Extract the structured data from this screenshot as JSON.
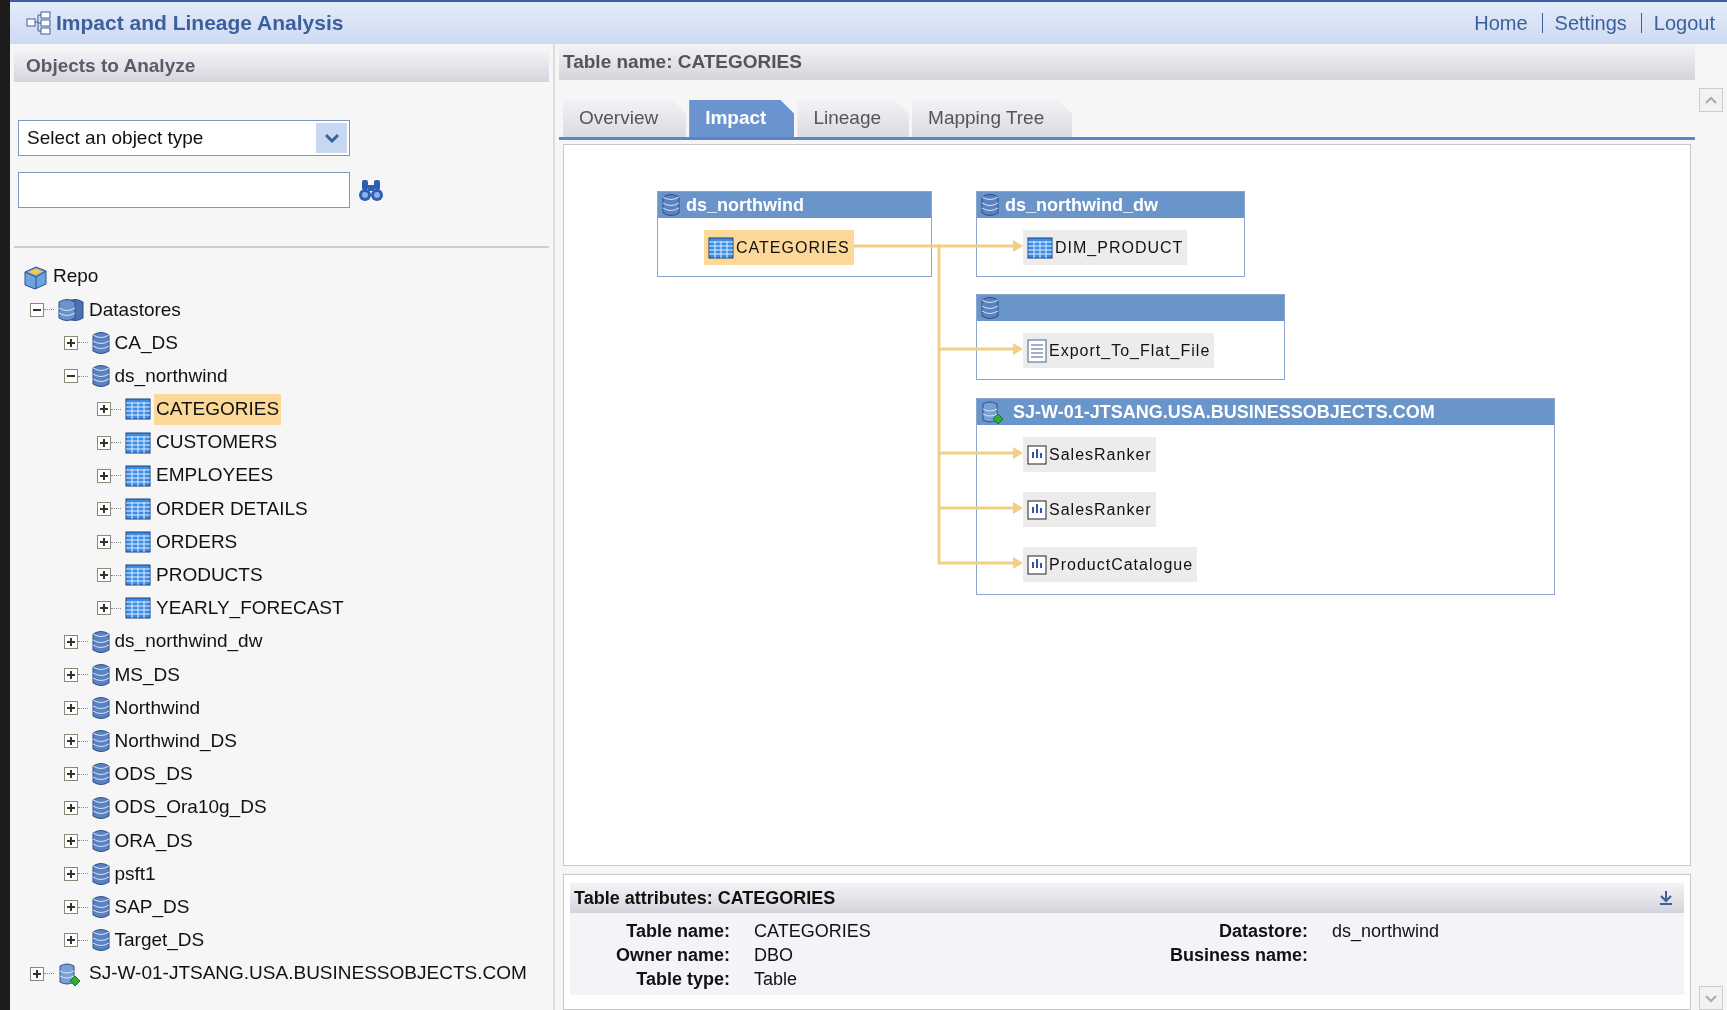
{
  "app": {
    "title": "Impact and Lineage Analysis",
    "links": [
      "Home",
      "Settings",
      "Logout"
    ]
  },
  "left_panel": {
    "title": "Objects to Analyze",
    "object_type": {
      "value": "Select an object type"
    },
    "tree": [
      {
        "label": "Repo",
        "kind": "repo",
        "selected": false,
        "children": [
          {
            "label": "Datastores",
            "kind": "datastores",
            "expanded": true,
            "selected": false,
            "children": [
              {
                "label": "CA_DS",
                "kind": "datastore",
                "expanded": false,
                "selected": false
              },
              {
                "label": "ds_northwind",
                "kind": "datastore",
                "expanded": true,
                "selected": false,
                "children": [
                  {
                    "label": "CATEGORIES",
                    "kind": "table",
                    "expanded": false,
                    "selected": true
                  },
                  {
                    "label": "CUSTOMERS",
                    "kind": "table",
                    "expanded": false,
                    "selected": false
                  },
                  {
                    "label": "EMPLOYEES",
                    "kind": "table",
                    "expanded": false,
                    "selected": false
                  },
                  {
                    "label": "ORDER DETAILS",
                    "kind": "table",
                    "expanded": false,
                    "selected": false
                  },
                  {
                    "label": "ORDERS",
                    "kind": "table",
                    "expanded": false,
                    "selected": false
                  },
                  {
                    "label": "PRODUCTS",
                    "kind": "table",
                    "expanded": false,
                    "selected": false
                  },
                  {
                    "label": "YEARLY_FORECAST",
                    "kind": "table",
                    "expanded": false,
                    "selected": false
                  }
                ]
              },
              {
                "label": "ds_northwind_dw",
                "kind": "datastore",
                "expanded": false,
                "selected": false
              },
              {
                "label": "MS_DS",
                "kind": "datastore",
                "expanded": false,
                "selected": false
              },
              {
                "label": "Northwind",
                "kind": "datastore",
                "expanded": false,
                "selected": false
              },
              {
                "label": "Northwind_DS",
                "kind": "datastore",
                "expanded": false,
                "selected": false
              },
              {
                "label": "ODS_DS",
                "kind": "datastore",
                "expanded": false,
                "selected": false
              },
              {
                "label": "ODS_Ora10g_DS",
                "kind": "datastore",
                "expanded": false,
                "selected": false
              },
              {
                "label": "ORA_DS",
                "kind": "datastore",
                "expanded": false,
                "selected": false
              },
              {
                "label": "psft1",
                "kind": "datastore",
                "expanded": false,
                "selected": false
              },
              {
                "label": "SAP_DS",
                "kind": "datastore",
                "expanded": false,
                "selected": false
              },
              {
                "label": "Target_DS",
                "kind": "datastore",
                "expanded": false,
                "selected": false
              }
            ]
          },
          {
            "label": "SJ-W-01-JTSANG.USA.BUSINESSOBJECTS.COM",
            "kind": "server",
            "expanded": false,
            "selected": false
          }
        ]
      }
    ]
  },
  "right_panel": {
    "title": "Table name: CATEGORIES",
    "tabs": [
      {
        "label": "Overview",
        "selected": false
      },
      {
        "label": "Impact",
        "selected": true
      },
      {
        "label": "Lineage",
        "selected": false
      },
      {
        "label": "Mapping Tree",
        "selected": false
      }
    ],
    "diagram": {
      "groups": [
        {
          "title": "ds_northwind",
          "kind": "datastore",
          "items": [
            {
              "label": "CATEGORIES",
              "kind": "table",
              "selected": true
            }
          ]
        },
        {
          "title": "ds_northwind_dw",
          "kind": "datastore",
          "items": [
            {
              "label": "DIM_PRODUCT",
              "kind": "table",
              "selected": false
            }
          ]
        },
        {
          "kind": "datastore",
          "items": [
            {
              "label": "Export_To_Flat_File",
              "kind": "file",
              "selected": false
            }
          ]
        },
        {
          "title": "SJ-W-01-JTSANG.USA.BUSINESSOBJECTS.COM",
          "kind": "server",
          "items": [
            {
              "label": "SalesRanker",
              "kind": "report",
              "selected": false
            },
            {
              "label": "SalesRanker",
              "kind": "report",
              "selected": false
            },
            {
              "label": "ProductCatalogue",
              "kind": "report",
              "selected": false
            }
          ]
        }
      ]
    },
    "attributes": {
      "title": "Table attributes: CATEGORIES",
      "fields": [
        {
          "label": "Table name:",
          "value": "CATEGORIES"
        },
        {
          "label": "Datastore:",
          "value": "ds_northwind"
        },
        {
          "label": "Owner name:",
          "value": "DBO"
        },
        {
          "label": "Business name:"
        },
        {
          "label": "Table type:",
          "value": "Table"
        }
      ]
    }
  }
}
